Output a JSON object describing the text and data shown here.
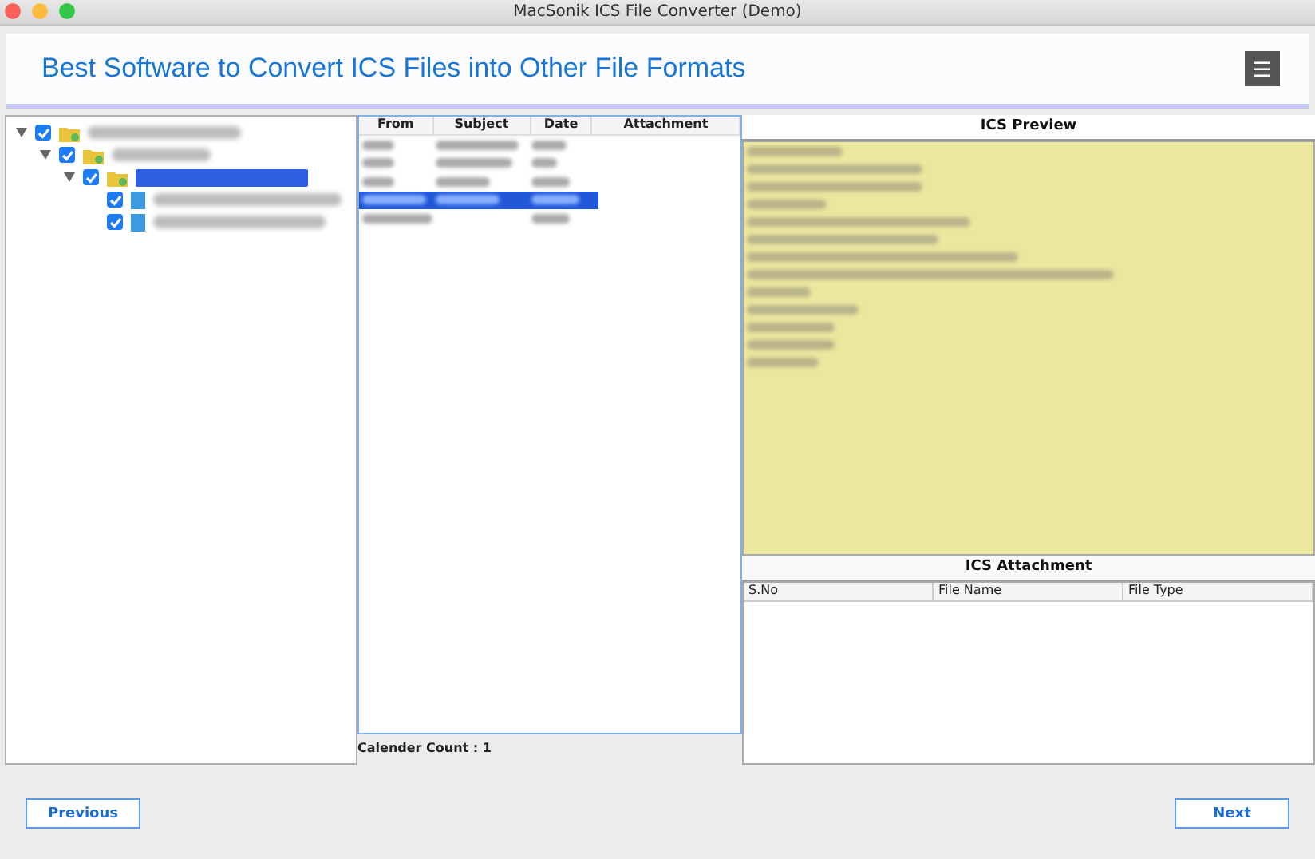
{
  "window": {
    "title": "MacSonik ICS File Converter (Demo)"
  },
  "header": {
    "title": "Best Software to Convert ICS Files into Other File Formats",
    "menu_button": "☰"
  },
  "tree": [
    {
      "checked": true,
      "expanded": true,
      "selected": false,
      "children": [
        {
          "checked": true,
          "expanded": true,
          "selected": false,
          "children": [
            {
              "checked": true,
              "expanded": true,
              "selected": true,
              "children": [
                {
                  "checked": true,
                  "selected": false
                },
                {
                  "checked": true,
                  "selected": false
                }
              ]
            }
          ]
        }
      ]
    }
  ],
  "calendar_table": {
    "columns": [
      "From",
      "Subject",
      "Date",
      "Attachment"
    ],
    "rows": [
      {
        "selected": false
      },
      {
        "selected": false
      },
      {
        "selected": false
      },
      {
        "selected": true
      },
      {
        "selected": false
      }
    ]
  },
  "calendar_count": "Calender Count : 1",
  "preview": {
    "title": "ICS Preview"
  },
  "attachments": {
    "title": "ICS Attachment",
    "columns": [
      "S.No",
      "File Name",
      "File Type"
    ]
  },
  "buttons": {
    "previous": "Previous",
    "next": "Next"
  }
}
